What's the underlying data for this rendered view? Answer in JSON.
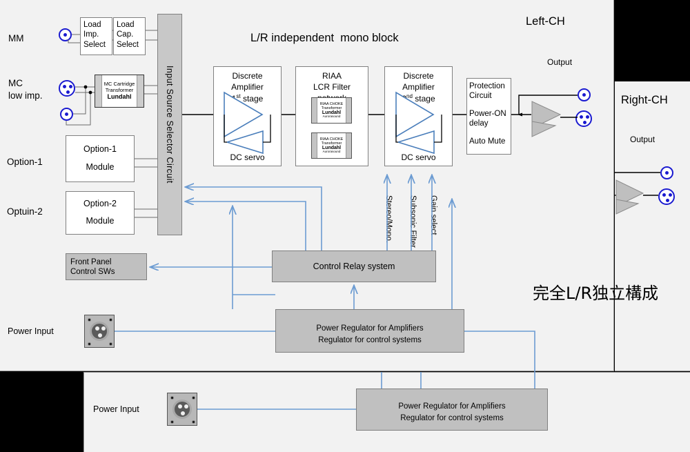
{
  "title": "L/R independent  mono block",
  "channels": {
    "left": "Left-CH",
    "right": "Right-CH"
  },
  "japanese_note": "完全L/R独立構成",
  "colors": {
    "panel_bg": "#f2f2f2",
    "box_gray": "#c0c0c0",
    "selector_gray": "#c8c8c8",
    "signal_line": "#000000",
    "control_line": "#6b9bd2",
    "connector_blue": "#1a1ad0",
    "amp_triangle_fill": "#c0c0c0",
    "amp_triangle_stroke": "#4a7ebb",
    "outside_black": "#000000"
  },
  "input_labels": {
    "mm": "MM",
    "mc": "MC\n low imp.",
    "option1": "Option-1",
    "option2": "Optuin-2",
    "power_input_left": "Power Input",
    "power_input_bottom": "Power Input"
  },
  "blocks": {
    "load_imp": "Load\nImp.\nSelect",
    "load_cap": "Load\nCap.\nSelect",
    "mc_transformer": {
      "line1": "MC Cartridge",
      "line2": "Transformer",
      "line3": "Lundahl"
    },
    "option1_module": {
      "line1": "Option-1",
      "line2": "Module"
    },
    "option2_module": {
      "line1": "Option-2",
      "line2": "Module"
    },
    "input_selector": "Input Source Selector Circuit",
    "amp1": {
      "line1": "Discrete",
      "line2": "Amplifier",
      "line3_pre": "1",
      "line3_sup": "st",
      "line3_post": " stage",
      "footer": "DC servo"
    },
    "riaa": {
      "line1": "RIAA",
      "line2": "LCR Filter",
      "line3": "network",
      "choke": {
        "c1": "RIAA CHOKE",
        "c2": "Transformer",
        "c3": "Lundahl",
        "c4": "Aurorasound"
      }
    },
    "amp2": {
      "line1": "Discrete",
      "line2": "Amplifier",
      "line3_pre": "2",
      "line3_sup": "nd",
      "line3_post": " stage",
      "footer": "DC servo"
    },
    "protection": {
      "line1": "Protection",
      "line2": "Circuit",
      "line3": "Power-ON",
      "line4": "delay",
      "line5": "Auto Mute"
    },
    "front_panel": "Front Panel\nControl SWs",
    "control_relay": "Control Relay system",
    "power_regulator_left": "Power Regulator  for Amplifiers\nRegulator  for control systems",
    "power_regulator_bottom": "Power Regulator  for Amplifiers\nRegulator  for control systems"
  },
  "control_signals": [
    "Stereo/Mono.",
    "Subsonic Filter",
    "Gain select"
  ],
  "output_labels": {
    "left": "Output",
    "right": "Output"
  },
  "connectors": {
    "rca_icon": "rca-jack-icon",
    "xlr_icon": "xlr-jack-icon",
    "power_icon": "power-inlet-icon"
  }
}
